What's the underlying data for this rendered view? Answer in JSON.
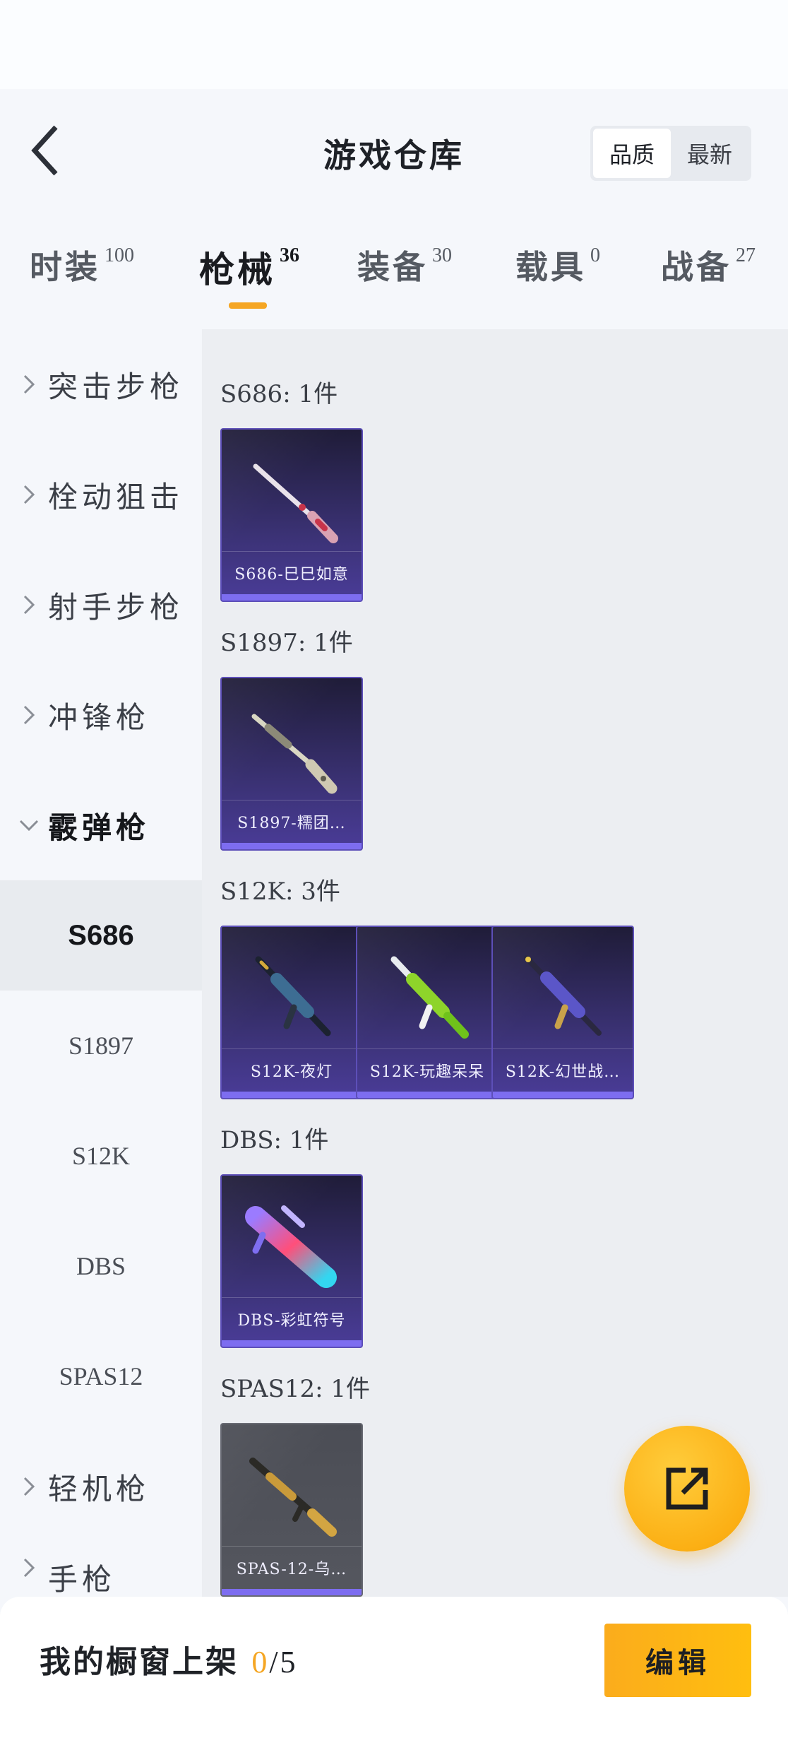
{
  "header": {
    "title": "游戏仓库",
    "sort_options": [
      {
        "label": "品质",
        "active": true
      },
      {
        "label": "最新",
        "active": false
      }
    ]
  },
  "tabs": [
    {
      "label": "时装",
      "count": "100",
      "active": false
    },
    {
      "label": "枪械",
      "count": "36",
      "active": true
    },
    {
      "label": "装备",
      "count": "30",
      "active": false
    },
    {
      "label": "载具",
      "count": "0",
      "active": false
    },
    {
      "label": "战备",
      "count": "27",
      "active": false
    }
  ],
  "sidebar": {
    "categories": [
      {
        "label": "突击步枪",
        "expanded": false
      },
      {
        "label": "栓动狙击",
        "expanded": false
      },
      {
        "label": "射手步枪",
        "expanded": false
      },
      {
        "label": "冲锋枪",
        "expanded": false
      },
      {
        "label": "霰弹枪",
        "expanded": true
      },
      {
        "label": "轻机枪",
        "expanded": false
      },
      {
        "label": "手枪",
        "expanded": false
      }
    ],
    "subitems": [
      {
        "label": "S686",
        "active": true
      },
      {
        "label": "S1897",
        "active": false
      },
      {
        "label": "S12K",
        "active": false
      },
      {
        "label": "DBS",
        "active": false
      },
      {
        "label": "SPAS12",
        "active": false
      }
    ]
  },
  "groups": [
    {
      "title": "S686: 1件",
      "items": [
        {
          "name": "S686-巳巳如意",
          "icon": "shotgun-double-barrel-icon",
          "rarity_color": "#7d6df0"
        }
      ]
    },
    {
      "title": "S1897: 1件",
      "items": [
        {
          "name": "S1897-糯团…",
          "icon": "pump-shotgun-icon",
          "rarity_color": "#7d6df0"
        }
      ]
    },
    {
      "title": "S12K: 3件",
      "items": [
        {
          "name": "S12K-夜灯",
          "icon": "auto-shotgun-icon",
          "rarity_color": "#7d6df0"
        },
        {
          "name": "S12K-玩趣呆呆",
          "icon": "auto-shotgun-icon",
          "rarity_color": "#7d6df0"
        },
        {
          "name": "S12K-幻世战…",
          "icon": "auto-shotgun-icon",
          "rarity_color": "#7d6df0"
        }
      ]
    },
    {
      "title": "DBS: 1件",
      "items": [
        {
          "name": "DBS-彩虹符号",
          "icon": "bullpup-shotgun-icon",
          "rarity_color": "#7d6df0"
        }
      ]
    },
    {
      "title": "SPAS12: 1件",
      "items": [
        {
          "name": "SPAS-12-乌…",
          "icon": "tactical-shotgun-icon",
          "rarity_color": "#7d6df0"
        }
      ]
    }
  ],
  "bottom": {
    "showcase_label": "我的橱窗上架",
    "current": "0",
    "max": "/5",
    "edit_label": "编辑"
  },
  "colors": {
    "accent": "#f5a623",
    "card_purple": "#3b3275",
    "rarity": "#7d6df0"
  }
}
